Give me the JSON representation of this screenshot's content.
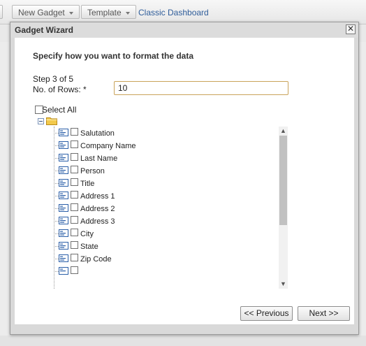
{
  "background": {
    "toolbar": {
      "new_gadget_label": "New Gadget",
      "template_label": "Template",
      "classic_dashboard_label": "Classic Dashboard"
    }
  },
  "dialog": {
    "title": "Gadget Wizard",
    "close_glyph": "✕",
    "heading": "Specify how you want to format the data",
    "step_text": "Step 3 of 5",
    "rows_label": "No. of Rows: *",
    "rows_value": "10",
    "select_all_label": "Select All",
    "fields": [
      {
        "label": "Salutation",
        "icon": "field-list-icon"
      },
      {
        "label": "Company Name",
        "icon": "field-list-icon"
      },
      {
        "label": "Last Name",
        "icon": "field-list-icon"
      },
      {
        "label": "Person",
        "icon": "field-list-icon"
      },
      {
        "label": "Title",
        "icon": "field-list-icon"
      },
      {
        "label": "Address 1",
        "icon": "field-list-icon"
      },
      {
        "label": "Address 2",
        "icon": "field-list-icon"
      },
      {
        "label": "Address 3",
        "icon": "field-list-icon"
      },
      {
        "label": "City",
        "icon": "field-list-icon"
      },
      {
        "label": "State",
        "icon": "field-list-icon"
      },
      {
        "label": "Zip Code",
        "icon": "field-list-icon"
      }
    ],
    "previous_label": "<< Previous",
    "next_label": "Next >>"
  },
  "colors": {
    "link": "#2f5d9a",
    "input_focus_border": "#c9a35a",
    "field_icon": "#2b5fa8",
    "folder": "#f2c94c"
  }
}
